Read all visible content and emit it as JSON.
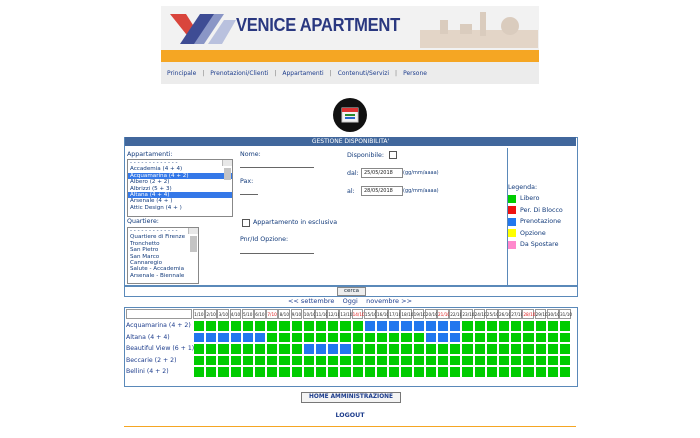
{
  "brand": {
    "name": "VENICE APARTMENT"
  },
  "nav": {
    "items": [
      "Principale",
      "Prenotazioni/Clienti",
      "Appartamenti",
      "Contenuti/Servizi",
      "Persone"
    ],
    "separator": "|"
  },
  "panel": {
    "title": "GESTIONE DISPONIBILITA'"
  },
  "form": {
    "appartamenti_label": "Appartamenti:",
    "appartamenti_options": [
      "- - - - - - - - - - - - -",
      "Accademia (4 + 4)",
      "Acquamarina (4 + 2)",
      "Albero (2 + 2)",
      "Albrizzi (5 + 3)",
      "Altana (4 + 4)",
      "Arsenale (4 + )",
      "Attic Design (4 + )"
    ],
    "appartamenti_selected": [
      2,
      5
    ],
    "quartiere_label": "Quartiere:",
    "quartiere_options": [
      "- - - - - - - - - - - - -",
      "Quartiere di Firenze",
      "Tronchetto",
      "San Pietro",
      "San Marco",
      "Cannaregio",
      "Salute - Accademia",
      "Arsenale - Biennale"
    ],
    "nome_label": "Nome:",
    "pax_label": "Pax:",
    "esclusiva_label": "Appartamento in esclusiva",
    "pnr_label": "Pnr/Id Opzione:",
    "disponibile_label": "Disponibile:",
    "dal_label": "dal:",
    "dal_value": "25/05/2018",
    "al_label": "al:",
    "al_value": "28/05/2018",
    "date_hint": "(gg/mm/aaaa)"
  },
  "legend": {
    "title": "Legenda:",
    "items": [
      {
        "label": "Libero",
        "color": "#00cc00"
      },
      {
        "label": "Per. Di Blocco",
        "color": "#ee1111"
      },
      {
        "label": "Prenotazione",
        "color": "#2277ee"
      },
      {
        "label": "Opzione",
        "color": "#ffff00"
      },
      {
        "label": "Da Spostare",
        "color": "#ff88cc"
      }
    ]
  },
  "search": {
    "button_label": "cerca"
  },
  "month_nav": {
    "prev": "<< settembre",
    "current": "Oggi",
    "next": "novembre >>"
  },
  "grid": {
    "days": [
      "1/10",
      "2/10",
      "3/10",
      "4/10",
      "5/10",
      "6/10",
      "7/10",
      "8/10",
      "9/10",
      "10/10",
      "11/10",
      "12/10",
      "13/10",
      "14/10",
      "15/10",
      "16/10",
      "17/10",
      "18/10",
      "19/10",
      "20/10",
      "21/10",
      "22/10",
      "23/10",
      "24/10",
      "25/10",
      "26/10",
      "27/10",
      "28/10",
      "29/10",
      "30/10",
      "31/10"
    ],
    "red_days": [
      7,
      14,
      21,
      28
    ],
    "apartments": [
      {
        "name": "Acquamarina (4 + 2)",
        "booked": [
          15,
          16,
          17,
          18,
          19,
          20,
          21,
          22
        ]
      },
      {
        "name": "Altana (4 + 4)",
        "booked": [
          1,
          2,
          3,
          4,
          5,
          6,
          20,
          21,
          22
        ]
      },
      {
        "name": "Beautiful View (6 + 1)",
        "booked": [
          10,
          11,
          12,
          13
        ]
      },
      {
        "name": "Beccarie (2 + 2)",
        "booked": []
      },
      {
        "name": "Bellini (4 + 2)",
        "booked": []
      }
    ]
  },
  "footer": {
    "home_label": "HOME AMMINISTRAZIONE",
    "logout_label": "LOGOUT"
  },
  "colors": {
    "free": "#00cc00",
    "booked": "#2277ee",
    "header_blue": "#41679c",
    "accent_orange": "#f5a623"
  }
}
